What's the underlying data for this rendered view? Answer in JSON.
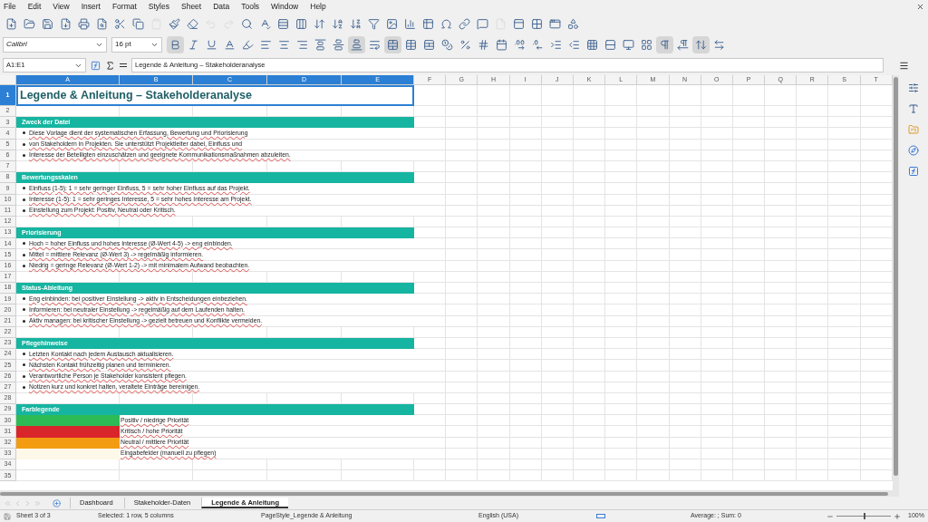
{
  "menu": [
    "File",
    "Edit",
    "View",
    "Insert",
    "Format",
    "Styles",
    "Sheet",
    "Data",
    "Tools",
    "Window",
    "Help"
  ],
  "toolbar_1": [
    {
      "kind": "new",
      "disabled": false
    },
    {
      "kind": "open",
      "disabled": false
    },
    {
      "kind": "save",
      "disabled": false
    },
    {
      "kind": "pdf",
      "disabled": false
    },
    {
      "kind": "print",
      "disabled": false
    },
    {
      "kind": "preview",
      "disabled": false
    },
    {
      "kind": "cut",
      "disabled": false
    },
    {
      "kind": "copy",
      "disabled": false
    },
    {
      "kind": "paste",
      "disabled": true
    },
    {
      "kind": "brush",
      "disabled": false
    },
    {
      "kind": "clear",
      "disabled": false
    },
    {
      "kind": "undo",
      "disabled": true
    },
    {
      "kind": "redo",
      "disabled": true
    },
    {
      "kind": "find",
      "disabled": false
    },
    {
      "kind": "spell",
      "disabled": false
    },
    {
      "kind": "row",
      "disabled": false
    },
    {
      "kind": "column",
      "disabled": false
    },
    {
      "kind": "sort",
      "disabled": false
    },
    {
      "kind": "sortasc",
      "disabled": false
    },
    {
      "kind": "sortdesc",
      "disabled": false
    },
    {
      "kind": "filter",
      "disabled": false
    },
    {
      "kind": "image",
      "disabled": false
    },
    {
      "kind": "chart",
      "disabled": false
    },
    {
      "kind": "pivot",
      "disabled": false
    },
    {
      "kind": "special",
      "disabled": false
    },
    {
      "kind": "link",
      "disabled": false
    },
    {
      "kind": "comment",
      "disabled": false
    },
    {
      "kind": "page",
      "disabled": true
    },
    {
      "kind": "freeze",
      "disabled": false
    },
    {
      "kind": "split",
      "disabled": false
    },
    {
      "kind": "window",
      "disabled": false
    },
    {
      "kind": "shapes",
      "disabled": false
    }
  ],
  "font_name": "Calibri",
  "font_size": "16 pt",
  "toolbar_2": [
    {
      "kind": "bold",
      "pressed": true
    },
    {
      "kind": "italic",
      "pressed": false
    },
    {
      "kind": "underline",
      "pressed": false
    },
    {
      "kind": "fontcolor",
      "pressed": false
    },
    {
      "kind": "highlight",
      "pressed": false
    },
    {
      "kind": "left",
      "pressed": false
    },
    {
      "kind": "center",
      "pressed": false
    },
    {
      "kind": "right",
      "pressed": false
    },
    {
      "kind": "top",
      "pressed": false
    },
    {
      "kind": "middle",
      "pressed": false
    },
    {
      "kind": "bottom",
      "pressed": true
    },
    {
      "kind": "wrap",
      "pressed": false
    },
    {
      "kind": "merge",
      "pressed": true
    },
    {
      "kind": "mergecells",
      "pressed": false
    },
    {
      "kind": "unmerge",
      "pressed": false
    },
    {
      "kind": "format",
      "pressed": false
    },
    {
      "kind": "percent",
      "pressed": false
    },
    {
      "kind": "number",
      "pressed": false
    },
    {
      "kind": "date",
      "pressed": false
    },
    {
      "kind": "adddecimal",
      "pressed": false
    },
    {
      "kind": "deldecimal",
      "pressed": false
    },
    {
      "kind": "indent",
      "pressed": false
    },
    {
      "kind": "outdent",
      "pressed": false
    },
    {
      "kind": "borders",
      "pressed": false
    },
    {
      "kind": "borderstyle",
      "pressed": false
    },
    {
      "kind": "bordercolor",
      "pressed": false
    },
    {
      "kind": "conditional",
      "pressed": false
    },
    {
      "kind": "ltr",
      "pressed": true
    },
    {
      "kind": "rtl",
      "pressed": false
    },
    {
      "kind": "vertical",
      "pressed": true
    },
    {
      "kind": "textdir",
      "pressed": false
    }
  ],
  "name_box": "A1:E1",
  "formula": "Legende & Anleitung – Stakeholderanalyse",
  "columns": [
    {
      "label": "A",
      "selected": true
    },
    {
      "label": "B",
      "selected": true
    },
    {
      "label": "C",
      "selected": true
    },
    {
      "label": "D",
      "selected": true
    },
    {
      "label": "E",
      "selected": true
    },
    {
      "label": "F",
      "selected": false
    },
    {
      "label": "G",
      "selected": false
    },
    {
      "label": "H",
      "selected": false
    },
    {
      "label": "I",
      "selected": false
    },
    {
      "label": "J",
      "selected": false
    },
    {
      "label": "K",
      "selected": false
    },
    {
      "label": "L",
      "selected": false
    },
    {
      "label": "M",
      "selected": false
    },
    {
      "label": "N",
      "selected": false
    },
    {
      "label": "O",
      "selected": false
    },
    {
      "label": "P",
      "selected": false
    },
    {
      "label": "Q",
      "selected": false
    },
    {
      "label": "R",
      "selected": false
    },
    {
      "label": "S",
      "selected": false
    },
    {
      "label": "T",
      "selected": false
    }
  ],
  "rows": [
    {
      "num": "1",
      "kind": "title",
      "text": "Legende & Anleitung – Stakeholderanalyse",
      "selected": true
    },
    {
      "num": "2",
      "kind": "blank",
      "selected": false
    },
    {
      "num": "3",
      "kind": "header",
      "text": "Zweck der Datei",
      "selected": false
    },
    {
      "num": "4",
      "kind": "bullet",
      "text": "Diese Vorlage dient der systematischen Erfassung, Bewertung und Priorisierung",
      "selected": false
    },
    {
      "num": "5",
      "kind": "bullet",
      "text": "von Stakeholdern in Projekten. Sie unterstützt Projektleiter dabei, Einfluss und",
      "selected": false
    },
    {
      "num": "6",
      "kind": "bullet",
      "text": "Interesse der Beteiligten einzuschätzen und geeignete Kommunikationsmaßnahmen abzuleiten.",
      "selected": false
    },
    {
      "num": "7",
      "kind": "blank",
      "selected": false
    },
    {
      "num": "8",
      "kind": "header",
      "text": "Bewertungsskalen",
      "selected": false
    },
    {
      "num": "9",
      "kind": "bullet",
      "text": "Einfluss (1-5): 1 = sehr geringer Einfluss, 5 = sehr hoher Einfluss auf das Projekt.",
      "selected": false
    },
    {
      "num": "10",
      "kind": "bullet",
      "text": "Interesse (1-5): 1 = sehr geringes Interesse, 5 = sehr hohes Interesse am Projekt.",
      "selected": false
    },
    {
      "num": "11",
      "kind": "bullet",
      "text": "Einstellung zum Projekt: Positiv, Neutral oder Kritisch.",
      "selected": false
    },
    {
      "num": "12",
      "kind": "blank",
      "selected": false
    },
    {
      "num": "13",
      "kind": "header",
      "text": "Priorisierung",
      "selected": false
    },
    {
      "num": "14",
      "kind": "bullet",
      "text": "Hoch = hoher Einfluss und hohes Interesse (Ø-Wert 4-5) -> eng einbinden.",
      "selected": false
    },
    {
      "num": "15",
      "kind": "bullet",
      "text": "Mittel = mittlere Relevanz (Ø-Wert 3) -> regelmäßig informieren.",
      "selected": false
    },
    {
      "num": "16",
      "kind": "bullet",
      "text": "Niedrig = geringe Relevanz (Ø-Wert 1-2) -> mit minimalem Aufwand beobachten.",
      "selected": false
    },
    {
      "num": "17",
      "kind": "blank",
      "selected": false
    },
    {
      "num": "18",
      "kind": "header",
      "text": "Status-Ableitung",
      "selected": false
    },
    {
      "num": "19",
      "kind": "bullet",
      "text": "Eng einbinden: bei positiver Einstellung -> aktiv in Entscheidungen einbeziehen.",
      "selected": false
    },
    {
      "num": "20",
      "kind": "bullet",
      "text": "Informieren: bei neutraler Einstellung -> regelmäßig auf dem Laufenden halten.",
      "selected": false
    },
    {
      "num": "21",
      "kind": "bullet",
      "text": "Aktiv managen: bei kritischer Einstellung -> gezielt betreuen und Konflikte vermeiden.",
      "selected": false
    },
    {
      "num": "22",
      "kind": "blank",
      "selected": false
    },
    {
      "num": "23",
      "kind": "header",
      "text": "Pflegehinweise",
      "selected": false
    },
    {
      "num": "24",
      "kind": "bullet",
      "text": "Letzten Kontakt nach jedem Austausch aktualisieren.",
      "selected": false
    },
    {
      "num": "25",
      "kind": "bullet",
      "text": "Nächsten Kontakt frühzeitig planen und terminieren.",
      "selected": false
    },
    {
      "num": "26",
      "kind": "bullet",
      "text": "Verantwortliche Person je Stakeholder konsistent pflegen.",
      "selected": false
    },
    {
      "num": "27",
      "kind": "bullet",
      "text": "Notizen kurz und konkret halten, veraltete Einträge bereinigen.",
      "selected": false
    },
    {
      "num": "28",
      "kind": "blank",
      "selected": false
    },
    {
      "num": "29",
      "kind": "header",
      "text": "Farblegende",
      "selected": false
    },
    {
      "num": "30",
      "kind": "legend",
      "color": "#2dbb55",
      "text": "Positiv / niedrige Priorität",
      "selected": false
    },
    {
      "num": "31",
      "kind": "legend",
      "color": "#d8262b",
      "text": "Kritisch / hohe Priorität",
      "selected": false
    },
    {
      "num": "32",
      "kind": "legend",
      "color": "#f39c12",
      "text": "Neutral / mittlere Priorität",
      "selected": false
    },
    {
      "num": "33",
      "kind": "legend",
      "color": "#fdf8e7",
      "text": "Eingabefelder (manuell zu pflegen)",
      "selected": false
    },
    {
      "num": "34",
      "kind": "blank",
      "selected": false
    },
    {
      "num": "35",
      "kind": "blank",
      "selected": false
    }
  ],
  "sheet_tabs": [
    {
      "label": "Dashboard",
      "selected": false
    },
    {
      "label": "Stakeholder-Daten",
      "selected": false
    },
    {
      "label": "Legende & Anleitung",
      "selected": true
    }
  ],
  "status_bar": {
    "sheet": "Sheet 3 of 3",
    "selection": "Selected: 1 row, 5 columns",
    "page_style": "PageStyle_Legende & Anleitung",
    "language": "English (USA)",
    "summary": "Average: ; Sum: 0",
    "zoom": "100%",
    "zoom_slider": {
      "level": 0.5
    }
  }
}
